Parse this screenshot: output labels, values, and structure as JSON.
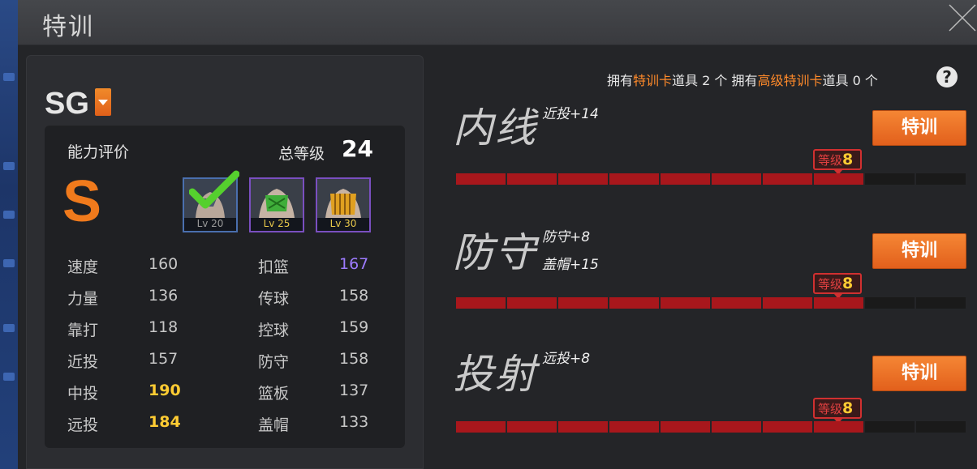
{
  "header": {
    "title": "特训"
  },
  "player": {
    "position": "SG",
    "eval_label": "能力评价",
    "total_level_label": "总等级",
    "total_level": "24",
    "grade": "S",
    "badges": [
      {
        "level": "Lv 20",
        "unlocked": true
      },
      {
        "level": "Lv 25",
        "unlocked": false
      },
      {
        "level": "Lv 30",
        "unlocked": false
      }
    ],
    "stats_left": [
      {
        "name": "速度",
        "value": "160",
        "color": "#c8c8c8"
      },
      {
        "name": "力量",
        "value": "136",
        "color": "#c8c8c8"
      },
      {
        "name": "靠打",
        "value": "118",
        "color": "#c8c8c8"
      },
      {
        "name": "近投",
        "value": "157",
        "color": "#c8c8c8"
      },
      {
        "name": "中投",
        "value": "190",
        "color": "#ffcc33"
      },
      {
        "name": "远投",
        "value": "184",
        "color": "#ffcc33"
      }
    ],
    "stats_right": [
      {
        "name": "扣篮",
        "value": "167",
        "color": "#9d7bff"
      },
      {
        "name": "传球",
        "value": "158",
        "color": "#c8c8c8"
      },
      {
        "name": "控球",
        "value": "159",
        "color": "#c8c8c8"
      },
      {
        "name": "防守",
        "value": "158",
        "color": "#c8c8c8"
      },
      {
        "name": "篮板",
        "value": "137",
        "color": "#c8c8c8"
      },
      {
        "name": "盖帽",
        "value": "133",
        "color": "#c8c8c8"
      }
    ]
  },
  "items_info": {
    "p1": "拥有",
    "card1": "特训卡",
    "p2": "道具 2 个 拥有",
    "card2": "高级特训卡",
    "p3": "道具 0 个"
  },
  "sections": [
    {
      "title": "内线",
      "bonuses": [
        "近投+14"
      ],
      "button": "特训",
      "level_label": "等级",
      "level": "8",
      "filled": 8,
      "total": 10
    },
    {
      "title": "防守",
      "bonuses": [
        "防守+8",
        "盖帽+15"
      ],
      "button": "特训",
      "level_label": "等级",
      "level": "8",
      "filled": 8,
      "total": 10
    },
    {
      "title": "投射",
      "bonuses": [
        "远投+8"
      ],
      "button": "特训",
      "level_label": "等级",
      "level": "8",
      "filled": 8,
      "total": 10
    }
  ],
  "colors": {
    "accent": "#f07a1c",
    "bar_on": "#a8171c",
    "bar_off": "#1a1a1a",
    "gold": "#ffcc33",
    "purple": "#9d7bff"
  }
}
